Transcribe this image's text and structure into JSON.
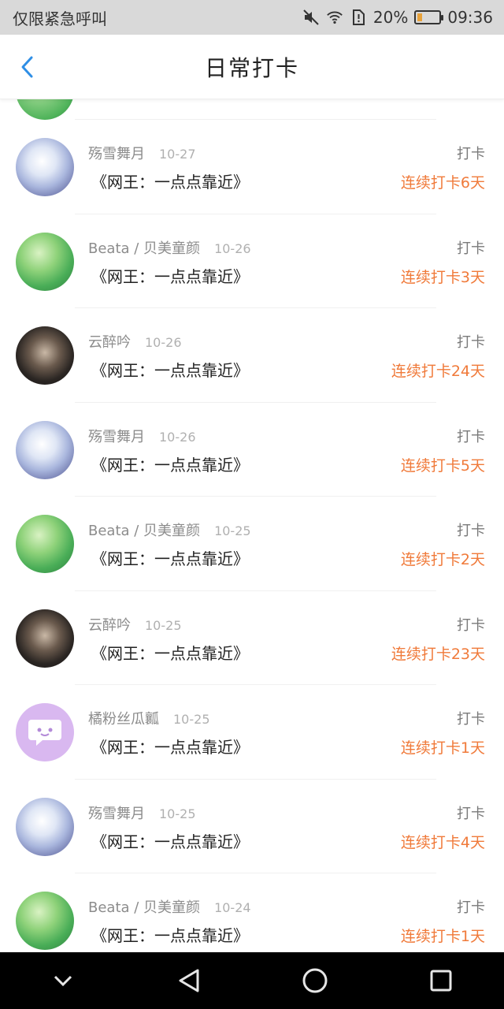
{
  "status_bar": {
    "carrier": "仅限紧急呼叫",
    "battery_percent": "20%",
    "battery_level": 0.2,
    "time": "09:36",
    "icons": [
      "mute-icon",
      "wifi-icon",
      "sim-alert-icon",
      "battery-icon"
    ]
  },
  "header": {
    "title": "日常打卡",
    "back_icon": "chevron-left-icon"
  },
  "checkins": [
    {
      "name": "殇雪舞月",
      "date": "10-27",
      "book": "《网王：一点点靠近》",
      "action": "打卡",
      "streak": "连续打卡6天",
      "avatar": "anime"
    },
    {
      "name": "Beata / 贝美童颜",
      "date": "10-26",
      "book": "《网王：一点点靠近》",
      "action": "打卡",
      "streak": "连续打卡3天",
      "avatar": "green"
    },
    {
      "name": "云醉吟",
      "date": "10-26",
      "book": "《网王：一点点靠近》",
      "action": "打卡",
      "streak": "连续打卡24天",
      "avatar": "dark"
    },
    {
      "name": "殇雪舞月",
      "date": "10-26",
      "book": "《网王：一点点靠近》",
      "action": "打卡",
      "streak": "连续打卡5天",
      "avatar": "anime"
    },
    {
      "name": "Beata / 贝美童颜",
      "date": "10-25",
      "book": "《网王：一点点靠近》",
      "action": "打卡",
      "streak": "连续打卡2天",
      "avatar": "green"
    },
    {
      "name": "云醉吟",
      "date": "10-25",
      "book": "《网王：一点点靠近》",
      "action": "打卡",
      "streak": "连续打卡23天",
      "avatar": "dark"
    },
    {
      "name": "橘粉丝瓜瓤",
      "date": "10-25",
      "book": "《网王：一点点靠近》",
      "action": "打卡",
      "streak": "连续打卡1天",
      "avatar": "purple"
    },
    {
      "name": "殇雪舞月",
      "date": "10-25",
      "book": "《网王：一点点靠近》",
      "action": "打卡",
      "streak": "连续打卡4天",
      "avatar": "anime"
    },
    {
      "name": "Beata / 贝美童颜",
      "date": "10-24",
      "book": "《网王：一点点靠近》",
      "action": "打卡",
      "streak": "连续打卡1天",
      "avatar": "green"
    }
  ],
  "colors": {
    "accent_blue": "#2f8fe6",
    "streak_orange": "#f07a3a",
    "status_bar_bg": "#d9d9d9"
  },
  "system_nav": {
    "buttons": [
      "collapse-chevron-icon",
      "back-triangle-icon",
      "home-circle-icon",
      "recents-square-icon"
    ]
  }
}
